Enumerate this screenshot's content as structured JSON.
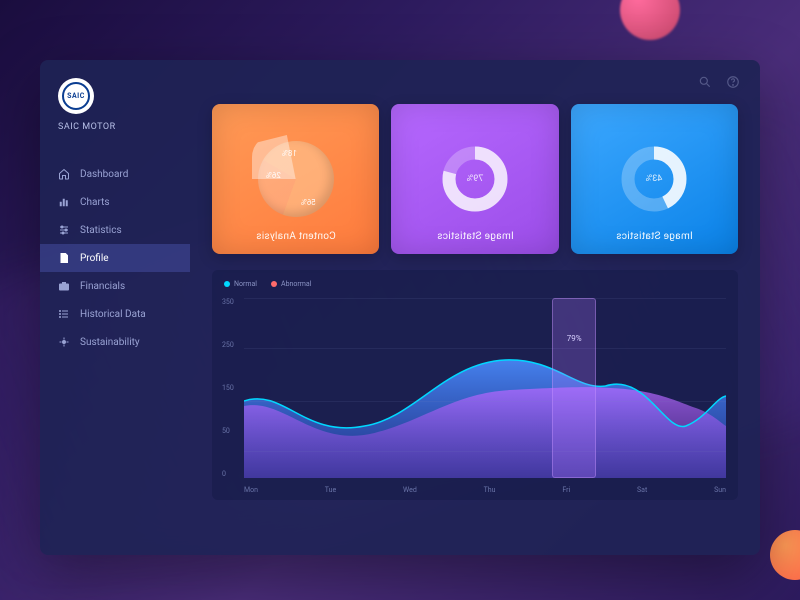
{
  "brand": {
    "logo_text": "SAIC",
    "name": "SAIC MOTOR"
  },
  "sidebar": {
    "items": [
      {
        "label": "Dashboard",
        "icon": "home-icon"
      },
      {
        "label": "Charts",
        "icon": "bars-icon"
      },
      {
        "label": "Statistics",
        "icon": "sliders-icon"
      },
      {
        "label": "Profile",
        "icon": "document-icon",
        "active": true
      },
      {
        "label": "Financials",
        "icon": "briefcase-icon"
      },
      {
        "label": "Historical Data",
        "icon": "list-icon"
      },
      {
        "label": "Sustainability",
        "icon": "sustainability-icon"
      }
    ]
  },
  "top_actions": {
    "search": "search",
    "help": "help"
  },
  "cards": {
    "c0": {
      "title": "Content Analysis",
      "type": "pie",
      "labels": {
        "a": "18%",
        "b": "26%",
        "c": "56%"
      }
    },
    "c1": {
      "title": "Image Statistics",
      "type": "donut",
      "percent_label": "79%",
      "percent": 79,
      "color": "purple"
    },
    "c2": {
      "title": "Image Statistics",
      "type": "donut",
      "percent_label": "43%",
      "percent": 43,
      "color": "blue"
    }
  },
  "chart_data": {
    "type": "area",
    "title": "",
    "xlabel": "",
    "ylabel": "",
    "ylim": [
      0,
      350
    ],
    "y_ticks": [
      "350",
      "250",
      "150",
      "50",
      "0"
    ],
    "categories": [
      "Mon",
      "Tue",
      "Wed",
      "Thu",
      "Fri",
      "Sat",
      "Sun"
    ],
    "series": [
      {
        "name": "Normal",
        "color": "#00d8ff",
        "values": [
          150,
          120,
          160,
          230,
          200,
          110,
          160
        ]
      },
      {
        "name": "Abnormal",
        "color": "#ff6b6b",
        "values": [
          140,
          100,
          130,
          170,
          180,
          150,
          120
        ]
      }
    ],
    "legend": {
      "items": [
        {
          "label": "Normal"
        },
        {
          "label": "Abnormal"
        }
      ]
    },
    "highlight": {
      "category": "Fri",
      "label": "79%"
    }
  }
}
